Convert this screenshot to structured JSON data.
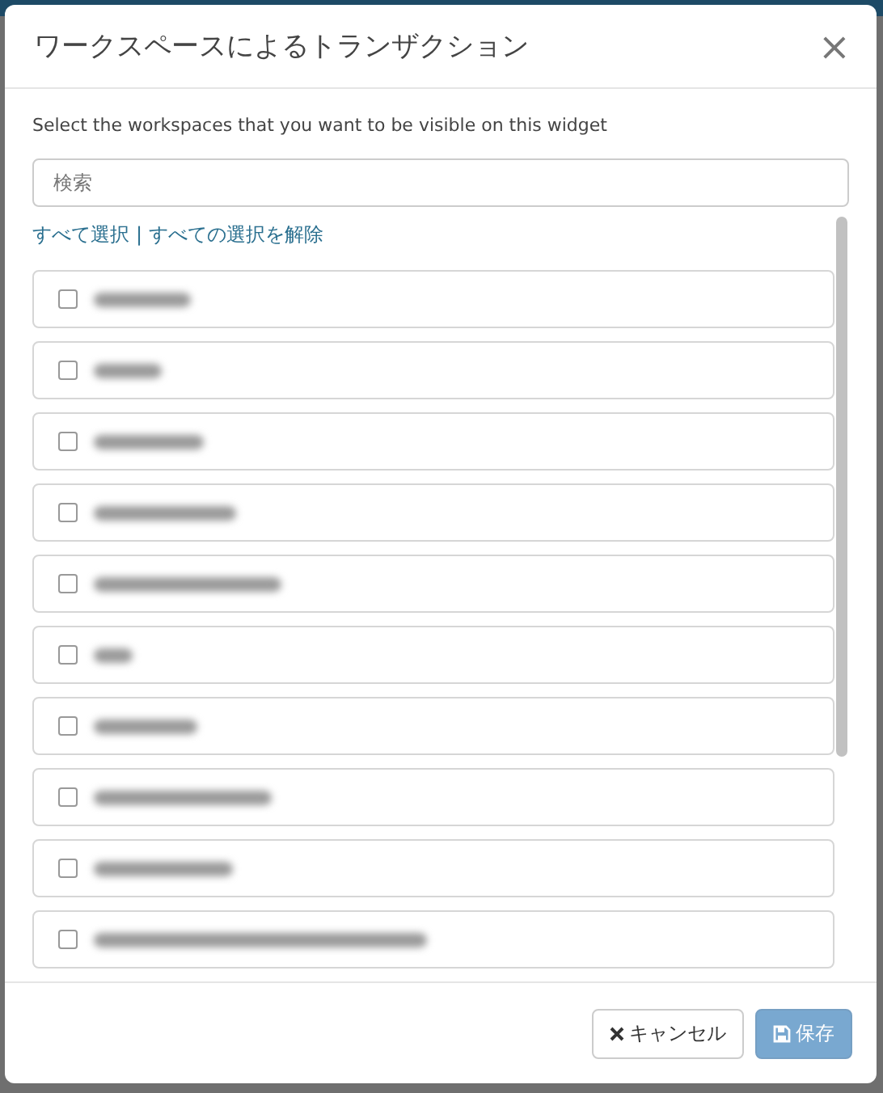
{
  "dialog": {
    "title": "ワークスペースによるトランザクション",
    "close": "×"
  },
  "description": "Select the workspaces that you want to be visible on this widget",
  "search": {
    "placeholder": "検索"
  },
  "links": [
    "すべて選択",
    "|",
    "すべての選択を解除"
  ],
  "workspaces": [
    {
      "checked": false
    },
    {
      "checked": false
    },
    {
      "checked": false
    },
    {
      "checked": false
    },
    {
      "checked": false
    },
    {
      "checked": false
    },
    {
      "checked": false
    },
    {
      "checked": false
    },
    {
      "checked": false
    },
    {
      "checked": false
    }
  ],
  "buttons": [
    {
      "kind": "cancel",
      "label": "キャンセル",
      "disabled": false
    },
    {
      "kind": "save",
      "label": "保存",
      "disabled": true
    }
  ]
}
